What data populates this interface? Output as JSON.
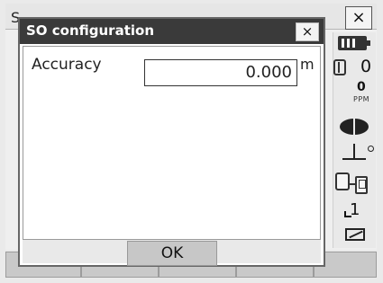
{
  "app": {
    "title_fragment": "S",
    "close_label": "×"
  },
  "status": {
    "prism_constant": "0",
    "ppm_value": "0",
    "ppm_label": "PPM",
    "input_mode": "1"
  },
  "dialog": {
    "title": "SO configuration",
    "close_label": "×",
    "accuracy_label": "Accuracy",
    "accuracy_value": "0.000",
    "accuracy_unit": "m",
    "ok_label": "OK"
  }
}
